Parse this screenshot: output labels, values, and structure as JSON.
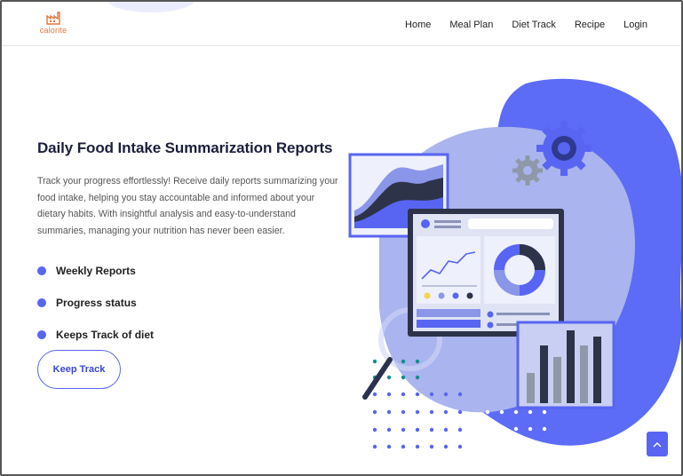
{
  "brand": {
    "name": "calorite",
    "logo_icon": "factory-icon",
    "accent": "#e0743a"
  },
  "nav": {
    "items": [
      "Home",
      "Meal Plan",
      "Diet Track",
      "Recipe",
      "Login"
    ]
  },
  "hero": {
    "title": "Daily Food Intake Summarization Reports",
    "description": "Track your progress effortlessly! Receive daily reports summarizing your food intake, helping you stay accountable and informed about your dietary habits. With insightful analysis and easy-to-understand summaries, managing your nutrition has never been easier.",
    "features": [
      "Weekly Reports",
      "Progress status",
      "Keeps Track of diet"
    ],
    "cta_label": "Keep Track"
  },
  "colors": {
    "primary": "#5865f2",
    "blob": "#5c6cf6",
    "light_blob": "#aab4ee"
  },
  "scroll_top": {
    "icon": "chevron-up-icon"
  }
}
